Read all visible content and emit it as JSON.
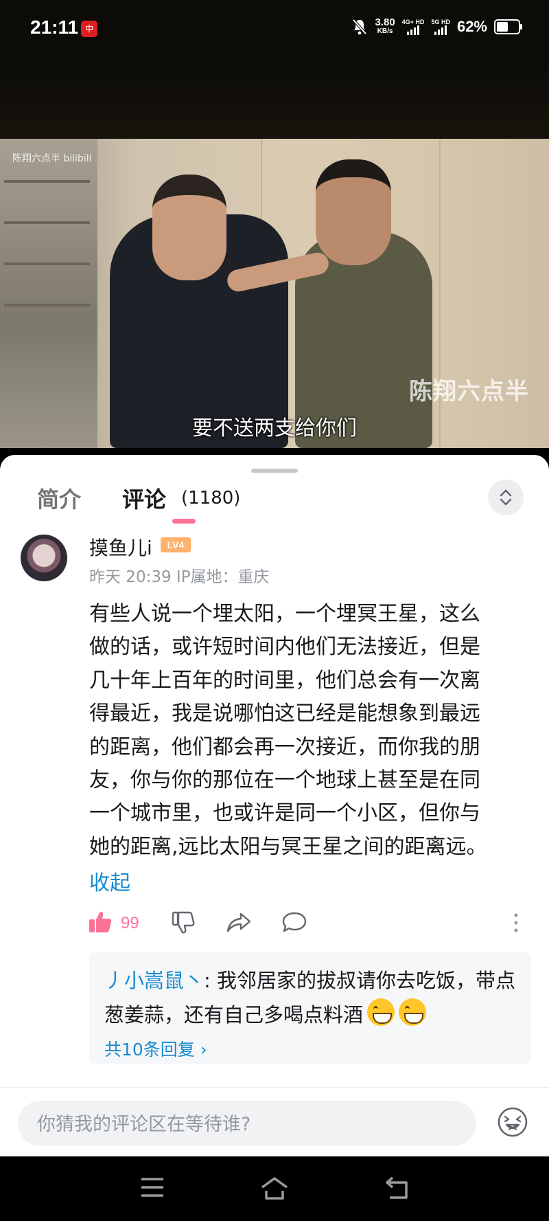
{
  "status_bar": {
    "time": "21:11",
    "app_badge": "中",
    "net_speed_value": "3.80",
    "net_speed_unit": "KB/s",
    "sim1": "4G+ HD",
    "sim2": "5G HD",
    "battery": "62%",
    "battery_level": 0.62
  },
  "video": {
    "watermark_top": "陈翔六点半 bilibili",
    "watermark_logo": "陈翔六点半",
    "subtitle": "要不送两支给你们"
  },
  "tabs": {
    "intro": "简介",
    "comments": "评论",
    "comment_count": "(1180)"
  },
  "comment": {
    "username": "摸鱼儿i",
    "level": "LV4",
    "meta": "昨天 20:39 IP属地：重庆",
    "lines": [
      "有些人说一个埋太阳，一个埋冥王星，这么",
      "做的话，或许短时间内他们无法接近，但是",
      "几十年上百年的时间里，他们总会有一次离",
      "得最近，我是说哪怕这已经是能想象到最远",
      "的距离，他们都会再一次接近，而你我的朋",
      "友，你与你的那位在一个地球上甚至是在同",
      "一个城市里，也或许是同一个小区，但你与",
      "她的距离,远比太阳与冥王星之间的距离远。"
    ],
    "collapse": "收起",
    "like_count": "99"
  },
  "reply": {
    "user": "丿小嵩鼠丶",
    "text": ": 我邻居家的拔叔请你去吃饭，带点葱姜蒜，还有自己多喝点料酒",
    "more": "共10条回复 ›"
  },
  "input": {
    "placeholder": "你猜我的评论区在等待谁?"
  },
  "colors": {
    "accent_pink": "#fb7299",
    "link_blue": "#178bcf"
  }
}
